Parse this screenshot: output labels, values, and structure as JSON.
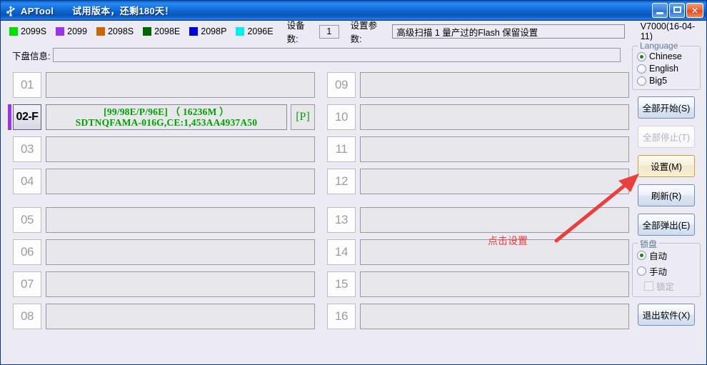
{
  "window": {
    "icon": "usb-icon",
    "title": "APTool",
    "subtitle": "试用版本，还剩180天！",
    "minimize_label": "_",
    "maximize_label": "□",
    "close_label": "✕",
    "titlebar_color": "#0d63cf"
  },
  "toolbar": {
    "legend": [
      {
        "label": "2099S",
        "color": "#00e000"
      },
      {
        "label": "2099",
        "color": "#9933ee"
      },
      {
        "label": "2098S",
        "color": "#cc6600"
      },
      {
        "label": "2098E",
        "color": "#006600"
      },
      {
        "label": "2098P",
        "color": "#0000dd"
      },
      {
        "label": "2096E",
        "color": "#00eeee"
      }
    ],
    "device_count_label": "设备数:",
    "device_count_value": "1",
    "param_label": "设置参数:",
    "param_value": "高级扫描 1 量产过的Flash 保留设置",
    "version": "V7000(16-04-11)"
  },
  "diskinfo": {
    "label": "下盘信息:",
    "value": ""
  },
  "grid": {
    "left_top": [
      {
        "num": "01",
        "text": "",
        "tag": "",
        "active": false
      },
      {
        "num": "02-F",
        "text": "[99/98E/P/96E] （ 16236M ）\nSDTNQFAMA-016G,CE:1,453AA4937A50",
        "tag": "[P]",
        "active": true
      },
      {
        "num": "03",
        "text": "",
        "tag": "",
        "active": false
      },
      {
        "num": "04",
        "text": "",
        "tag": "",
        "active": false
      }
    ],
    "left_bottom": [
      {
        "num": "05",
        "text": "",
        "tag": "",
        "active": false
      },
      {
        "num": "06",
        "text": "",
        "tag": "",
        "active": false
      },
      {
        "num": "07",
        "text": "",
        "tag": "",
        "active": false
      },
      {
        "num": "08",
        "text": "",
        "tag": "",
        "active": false
      }
    ],
    "right_top": [
      {
        "num": "09",
        "text": "",
        "tag": "",
        "active": false
      },
      {
        "num": "10",
        "text": "",
        "tag": "",
        "active": false
      },
      {
        "num": "11",
        "text": "",
        "tag": "",
        "active": false
      },
      {
        "num": "12",
        "text": "",
        "tag": "",
        "active": false
      }
    ],
    "right_bottom": [
      {
        "num": "13",
        "text": "",
        "tag": "",
        "active": false
      },
      {
        "num": "14",
        "text": "",
        "tag": "",
        "active": false
      },
      {
        "num": "15",
        "text": "",
        "tag": "",
        "active": false
      },
      {
        "num": "16",
        "text": "",
        "tag": "",
        "active": false
      }
    ]
  },
  "sidepanel": {
    "language_group": {
      "title": "Language",
      "options": [
        {
          "label": "Chinese",
          "checked": true
        },
        {
          "label": "English",
          "checked": false
        },
        {
          "label": "Big5",
          "checked": false
        }
      ]
    },
    "buttons_top": [
      {
        "label": "全部开始(S)",
        "state": "normal"
      },
      {
        "label": "全部停止(T)",
        "state": "disabled"
      },
      {
        "label": "设置(M)",
        "state": "highlight"
      },
      {
        "label": "刷新(R)",
        "state": "normal"
      },
      {
        "label": "全部弹出(E)",
        "state": "normal"
      }
    ],
    "lock_group": {
      "title": "锁盘",
      "options": [
        {
          "label": "自动",
          "checked": true
        },
        {
          "label": "手动",
          "checked": false
        }
      ],
      "checkbox_label": "锁定",
      "checkbox_checked": false
    },
    "exit_button": {
      "label": "退出软件(X)"
    }
  },
  "annotation": {
    "text": "点击设置",
    "color": "#e8403c"
  }
}
